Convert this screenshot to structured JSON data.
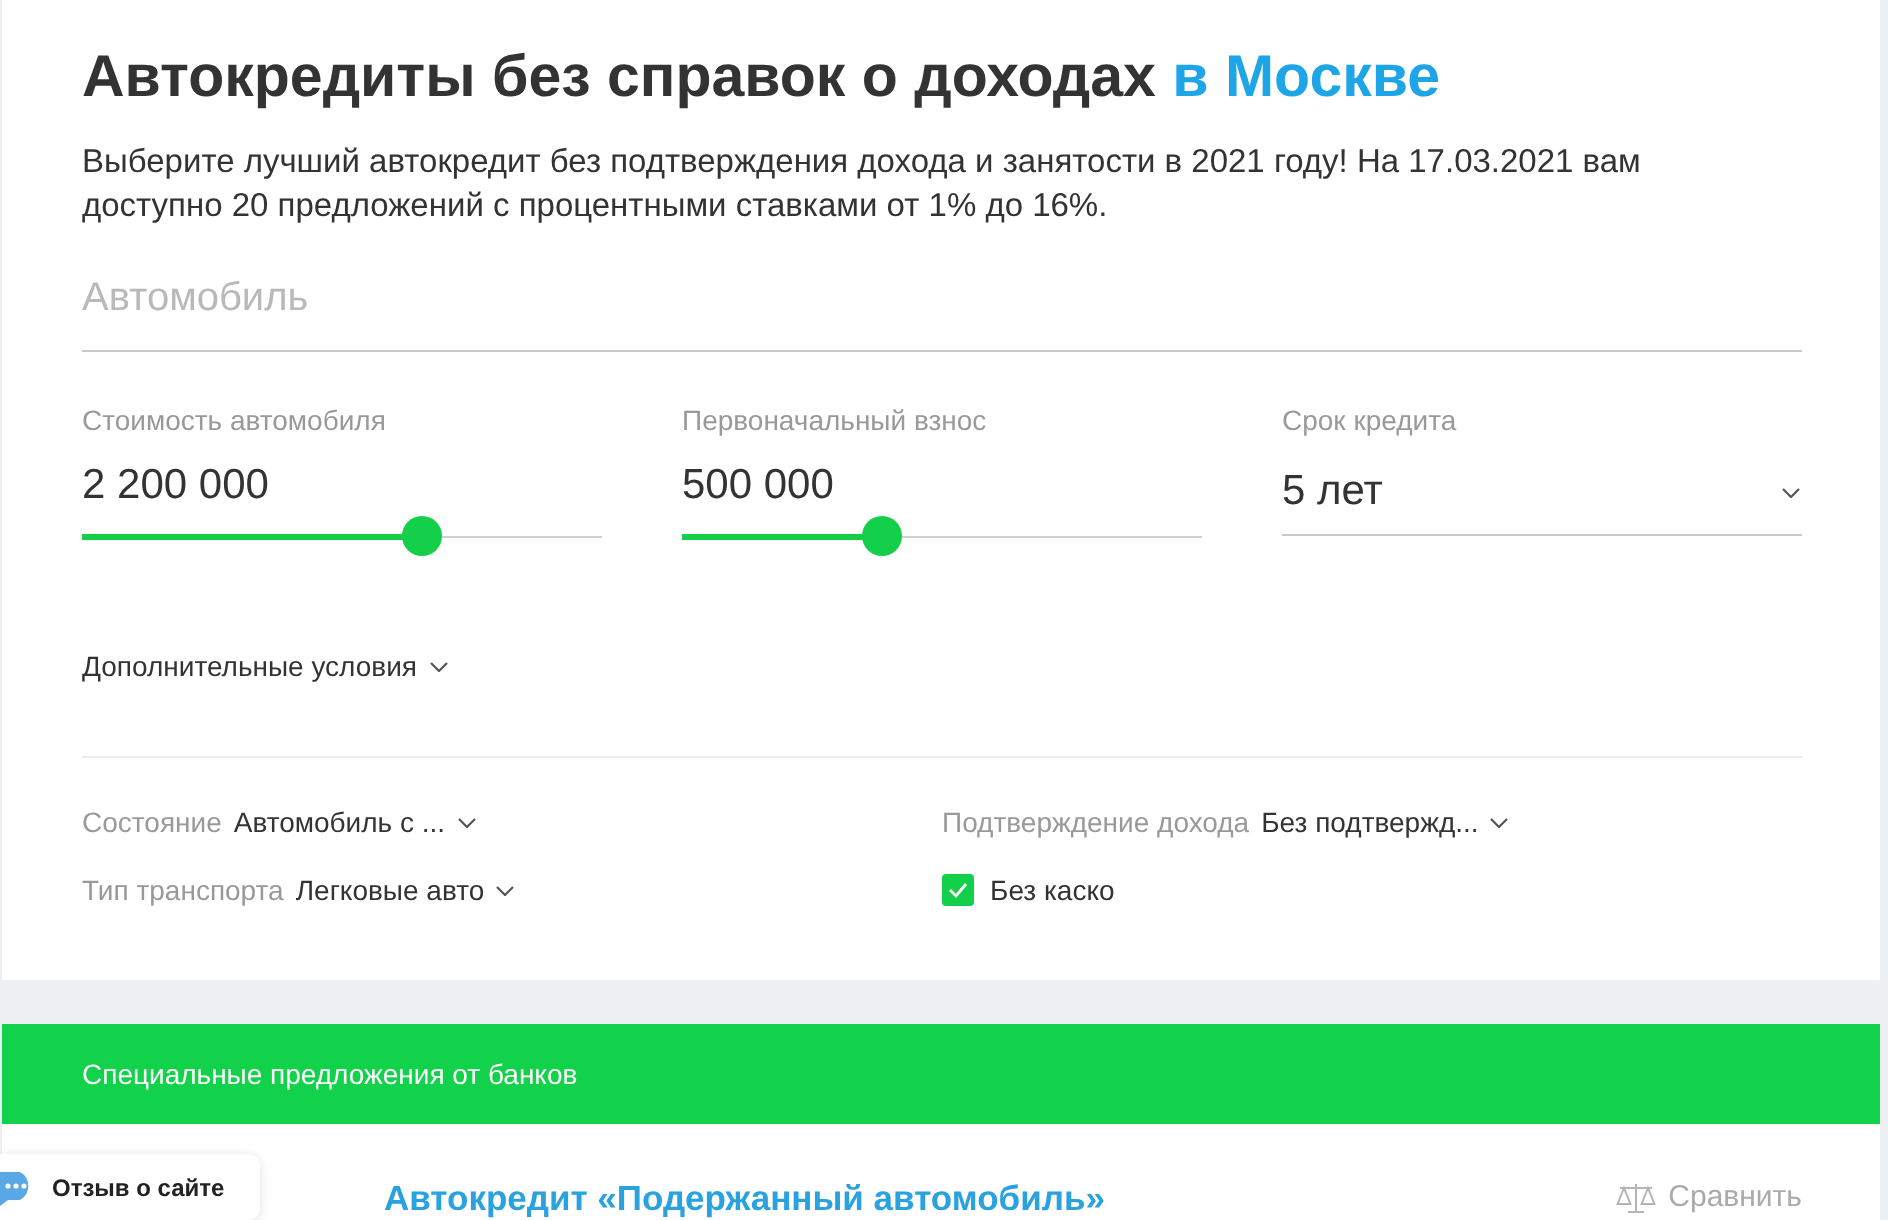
{
  "heading": {
    "title": "Автокредиты без справок о доходах",
    "city": "в Москве"
  },
  "intro": "Выберите лучший автокредит без подтверждения дохода и занятости в 2021 году! На 17.03.2021 вам доступно 20 предложений с процентными ставками от 1% до 16%.",
  "car_field": {
    "placeholder": "Автомобиль"
  },
  "fields": [
    {
      "kind": "slider",
      "label": "Стоимость автомобиля",
      "value": "2 200 000",
      "level": 0.654
    },
    {
      "kind": "slider",
      "label": "Первоначальный взнос",
      "value": "500 000",
      "level": 0.385
    },
    {
      "kind": "select",
      "label": "Срок кредита",
      "value": "5 лет"
    }
  ],
  "more_conditions": {
    "label": "Дополнительные условия"
  },
  "filters": [
    {
      "kind": "select",
      "label": "Состояние",
      "value": "Автомобиль с ..."
    },
    {
      "kind": "select",
      "label": "Подтверждение дохода",
      "value": "Без подтвержд..."
    },
    {
      "kind": "select",
      "label": "Тип транспорта",
      "value": "Легковые авто"
    },
    {
      "kind": "checkbox",
      "label": "Без каско",
      "checked": true
    }
  ],
  "special_offers": {
    "title": "Специальные предложения от банков"
  },
  "offer": {
    "title": "Автокредит «Подержанный автомобиль»",
    "compare": "Сравнить"
  },
  "feedback_widget": {
    "label": "Отзыв о сайте"
  }
}
